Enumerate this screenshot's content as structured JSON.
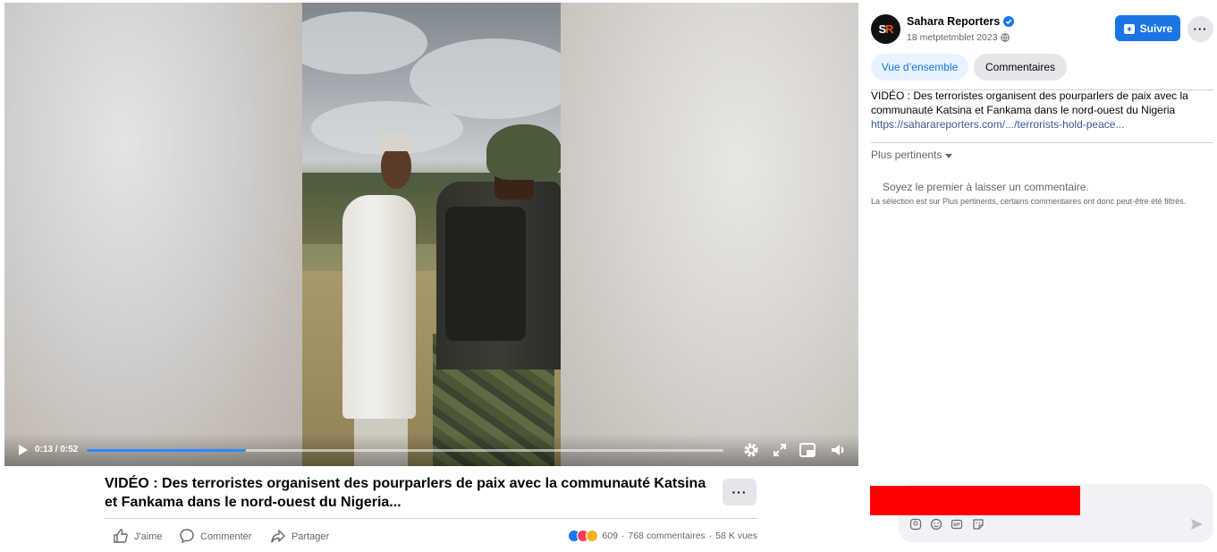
{
  "video": {
    "time_display": "0:13 / 0:52",
    "progress_fraction": 0.25,
    "accent_color": "#2d88ff"
  },
  "post": {
    "caption": "VIDÉO : Des terroristes organisent des pourparlers de paix avec la communauté Katsina et Fankama dans le nord-ouest du Nigeria...",
    "more_label": "···",
    "actions": {
      "like": "J'aime",
      "comment": "Commenter",
      "share": "Partager"
    },
    "stats": {
      "reactions": "609",
      "comments": "768 commentaires",
      "views": "58 K vues",
      "separator": "·"
    }
  },
  "panel": {
    "avatar_text_1": "S",
    "avatar_text_2": "R",
    "page_name": "Sahara Reporters",
    "date": "18 metptetmblet 2023",
    "follow_label": "Suivre",
    "more_label": "···",
    "tabs": [
      {
        "label": "Vue d’ensemble"
      },
      {
        "label": "Commentaires"
      }
    ],
    "description": "VIDÉO : Des terroristes organisent des pourparlers de paix avec la communauté Katsina et Fankama dans le nord-ouest du Nigeria",
    "link": "https://saharareporters.com/.../terrorists-hold-peace...",
    "sort_label": "Plus pertinents",
    "empty_title": "Soyez le premier à laisser un commentaire.",
    "empty_note": "La sélection est sur Plus pertinents, certains commentaires ont donc peut-être été filtrés.",
    "brand_color": "#1b74e4",
    "redaction_color": "#ff0000"
  },
  "icons": {
    "play": "play-icon",
    "settings": "gear-icon",
    "fullscreen": "expand-icon",
    "pip": "picture-in-picture-icon",
    "volume": "volume-icon",
    "like": "thumbs-up-icon",
    "comment": "comment-bubble-icon",
    "share": "share-arrow-icon",
    "verified": "verified-badge-icon",
    "globe": "globe-icon",
    "send": "send-icon"
  }
}
